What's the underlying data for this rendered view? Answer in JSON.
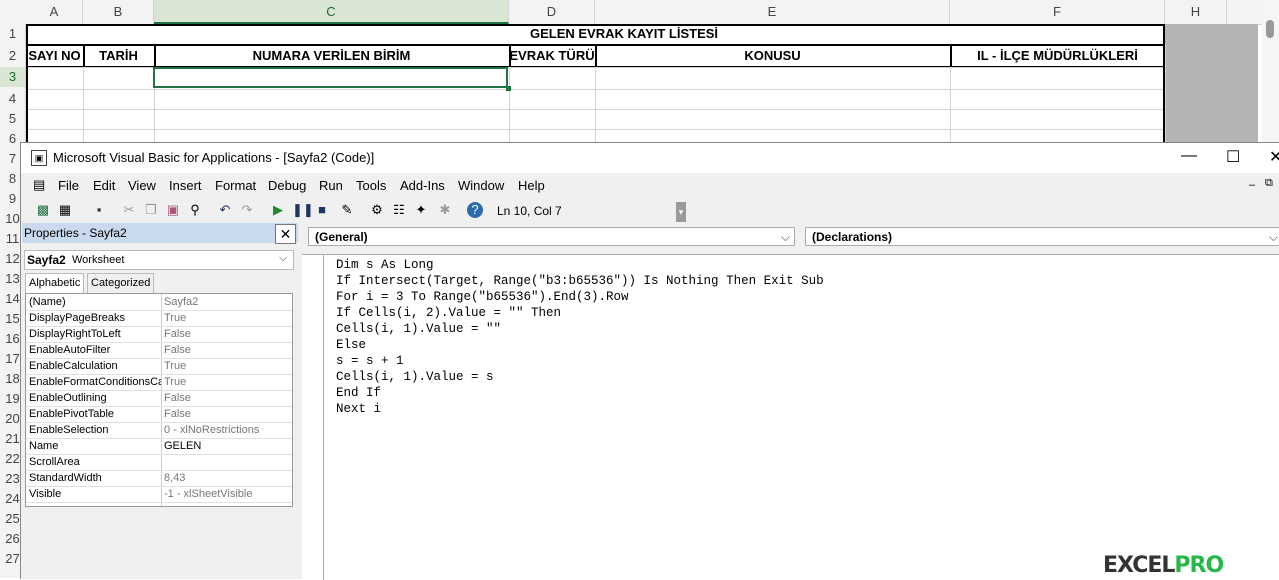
{
  "spreadsheet": {
    "columns": [
      "A",
      "B",
      "C",
      "D",
      "E",
      "F",
      "H"
    ],
    "rows": [
      "1",
      "2",
      "3",
      "4",
      "5",
      "6",
      "7",
      "8",
      "9",
      "10",
      "11",
      "12",
      "13",
      "14",
      "15",
      "16",
      "17",
      "18",
      "19",
      "20",
      "21",
      "22",
      "23",
      "24",
      "25",
      "26",
      "27"
    ],
    "title": "GELEN EVRAK KAYIT LİSTESİ",
    "headers": [
      "SAYI NO",
      "TARİH",
      "NUMARA VERİLEN BİRİM",
      "EVRAK TÜRÜ",
      "KONUSU",
      "IL - İLÇE MÜDÜRLÜKLERİ"
    ],
    "selected_cell": "C3"
  },
  "vba": {
    "title": "Microsoft Visual Basic for Applications - [Sayfa2 (Code)]",
    "menu": [
      "File",
      "Edit",
      "View",
      "Insert",
      "Format",
      "Debug",
      "Run",
      "Tools",
      "Add-Ins",
      "Window",
      "Help"
    ],
    "status": "Ln 10, Col 7",
    "properties": {
      "title": "Properties - Sayfa2",
      "object_name": "Sayfa2",
      "object_type": "Worksheet",
      "tabs": [
        "Alphabetic",
        "Categorized"
      ],
      "rows": [
        {
          "name": "(Name)",
          "value": "Sayfa2"
        },
        {
          "name": "DisplayPageBreaks",
          "value": "True"
        },
        {
          "name": "DisplayRightToLeft",
          "value": "False"
        },
        {
          "name": "EnableAutoFilter",
          "value": "False"
        },
        {
          "name": "EnableCalculation",
          "value": "True"
        },
        {
          "name": "EnableFormatConditionsCal",
          "value": "True"
        },
        {
          "name": "EnableOutlining",
          "value": "False"
        },
        {
          "name": "EnablePivotTable",
          "value": "False"
        },
        {
          "name": "EnableSelection",
          "value": "0 - xlNoRestrictions"
        },
        {
          "name": "Name",
          "value": "GELEN"
        },
        {
          "name": "ScrollArea",
          "value": ""
        },
        {
          "name": "StandardWidth",
          "value": "8,43"
        },
        {
          "name": "Visible",
          "value": "-1 - xlSheetVisible"
        }
      ]
    },
    "code": {
      "object_combo": "(General)",
      "proc_combo": "(Declarations)",
      "text": "Dim s As Long\nIf Intersect(Target, Range(\"b3:b65536\")) Is Nothing Then Exit Sub\nFor i = 3 To Range(\"b65536\").End(3).Row\nIf Cells(i, 2).Value = \"\" Then\nCells(i, 1).Value = \"\"\nElse\ns = s + 1\nCells(i, 1).Value = s\nEnd If\nNext i"
    }
  },
  "watermark": {
    "left": "EXCEL",
    "right": "PRO"
  }
}
